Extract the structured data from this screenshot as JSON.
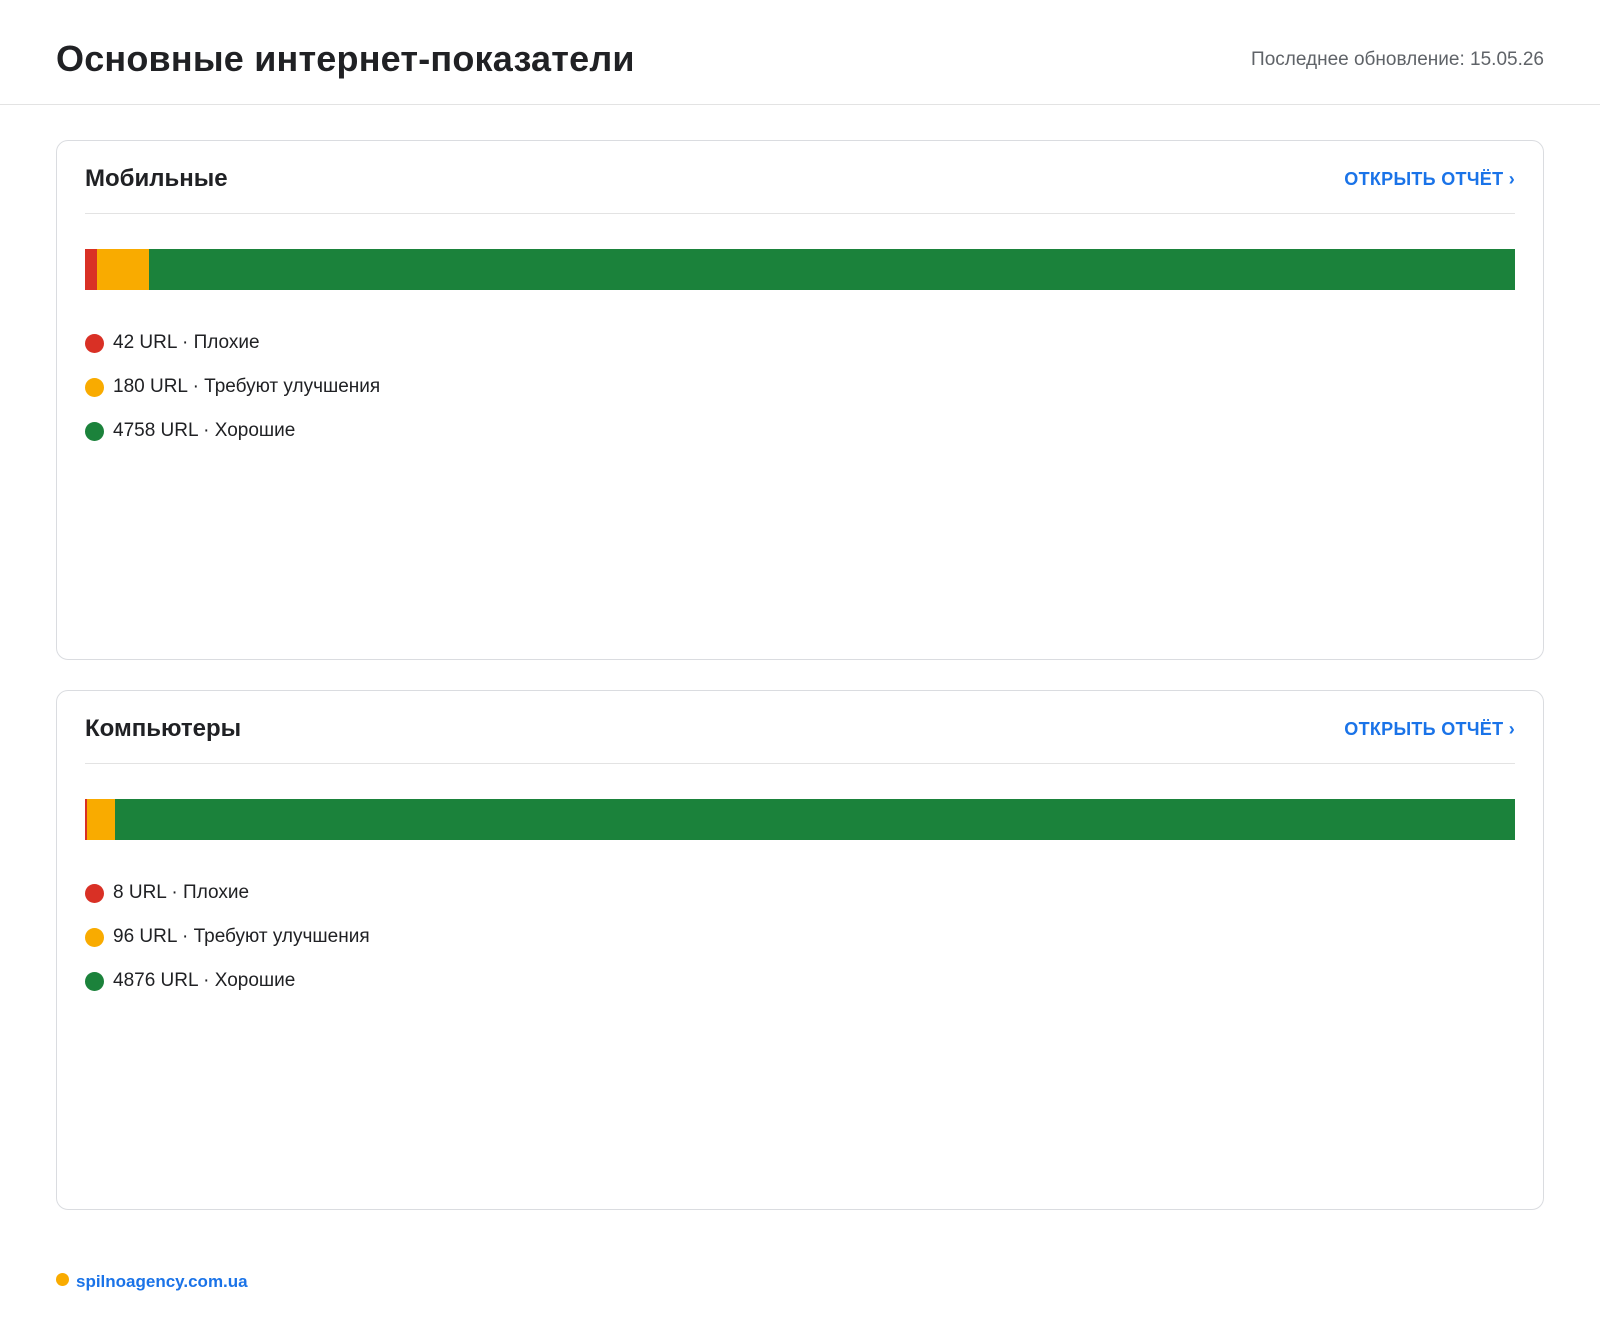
{
  "header": {
    "title": "Основные интернет-показатели",
    "updated": "Последнее обновление: 15.05.26"
  },
  "colors": {
    "poor": "#d93025",
    "needs_improvement": "#f9ab00",
    "good": "#1b823b",
    "link": "#1a73e8"
  },
  "cards": [
    {
      "title": "Мобильные",
      "link_label": "ОТКРЫТЬ ОТЧЁТ ›",
      "legend": [
        "42 URL · Плохие",
        "180 URL · Требуют улучшения",
        "4758 URL · Хорошие"
      ]
    },
    {
      "title": "Компьютеры",
      "link_label": "ОТКРЫТЬ ОТЧЁТ ›",
      "legend": [
        "8 URL · Плохие",
        "96 URL · Требуют улучшения",
        "4876 URL · Хорошие"
      ]
    }
  ],
  "chart_data": [
    {
      "type": "bar",
      "stacked": true,
      "orientation": "horizontal",
      "categories": [
        "Мобильные"
      ],
      "series": [
        {
          "name": "Плохие",
          "values": [
            42
          ],
          "color": "#d93025"
        },
        {
          "name": "Требуют улучшения",
          "values": [
            180
          ],
          "color": "#f9ab00"
        },
        {
          "name": "Хорошие",
          "values": [
            4758
          ],
          "color": "#1b823b"
        }
      ]
    },
    {
      "type": "bar",
      "stacked": true,
      "orientation": "horizontal",
      "categories": [
        "Компьютеры"
      ],
      "series": [
        {
          "name": "Плохие",
          "values": [
            8
          ],
          "color": "#d93025"
        },
        {
          "name": "Требуют улучшения",
          "values": [
            96
          ],
          "color": "#f9ab00"
        },
        {
          "name": "Хорошие",
          "values": [
            4876
          ],
          "color": "#1b823b"
        }
      ]
    }
  ],
  "footer": {
    "link": "spilnoagency.com.ua",
    "dot_color": "#f9ab00"
  }
}
